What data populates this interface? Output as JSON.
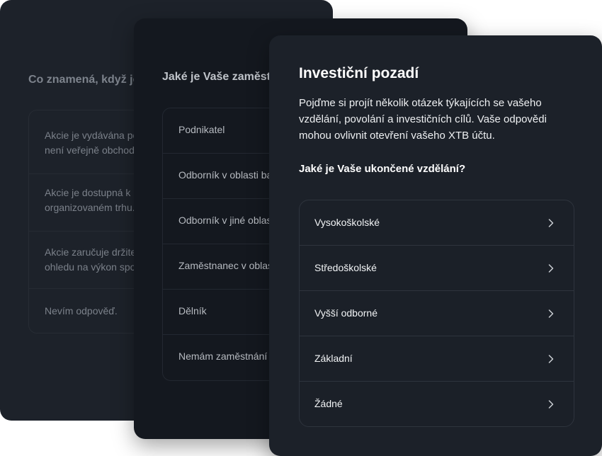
{
  "back_card": {
    "question": "Co znamená, když je",
    "options": [
      "Akcie je vydávána po\nnení veřejně obchodo",
      "Akcie je dostupná k n\norganizovaném trhu.",
      "Akcie zaručuje držitel\nohledu na výkon spol",
      "Nevím odpověď."
    ]
  },
  "mid_card": {
    "question": "Jaké je Vaše zaměst",
    "options": [
      "Podnikatel",
      "Odborník v oblasti ban",
      "Odborník v jiné oblast",
      "Zaměstnanec v oblas",
      "Dělník",
      "Nemám zaměstnání"
    ]
  },
  "front_card": {
    "title": "Investiční pozadí",
    "intro": "Pojďme si projít několik otázek týkajících se vašeho vzdělání, povolání a investičních cílů. Vaše odpovědi mohou ovlivnit otevření vašeho XTB účtu.",
    "question": "Jaké je Vaše ukončené vzdělání?",
    "options": [
      "Vysokoškolské",
      "Středoškolské",
      "Vyšší odborné",
      "Základní",
      "Žádné"
    ],
    "option_icon": "chevron-right-icon"
  }
}
